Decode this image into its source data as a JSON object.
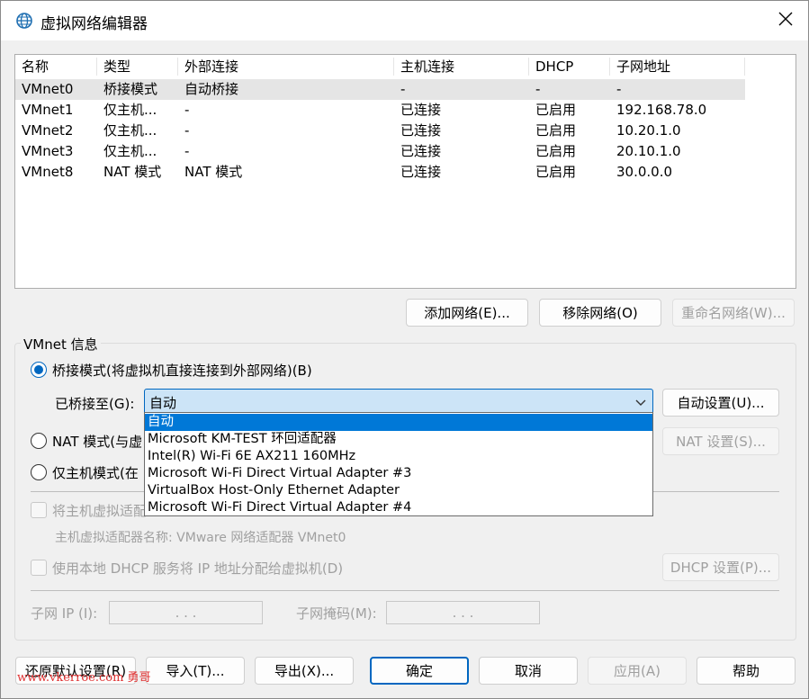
{
  "window": {
    "title": "虚拟网络编辑器"
  },
  "table": {
    "columns": [
      "名称",
      "类型",
      "外部连接",
      "主机连接",
      "DHCP",
      "子网地址"
    ],
    "rows": [
      [
        "VMnet0",
        "桥接模式",
        "自动桥接",
        "-",
        "-",
        "-"
      ],
      [
        "VMnet1",
        "仅主机...",
        "-",
        "已连接",
        "已启用",
        "192.168.78.0"
      ],
      [
        "VMnet2",
        "仅主机...",
        "-",
        "已连接",
        "已启用",
        "10.20.1.0"
      ],
      [
        "VMnet3",
        "仅主机...",
        "-",
        "已连接",
        "已启用",
        "20.10.1.0"
      ],
      [
        "VMnet8",
        "NAT 模式",
        "NAT 模式",
        "已连接",
        "已启用",
        "30.0.0.0"
      ]
    ],
    "selected_row": 0
  },
  "list_buttons": {
    "add": "添加网络(E)...",
    "remove": "移除网络(O)",
    "rename": "重命名网络(W)..."
  },
  "vmnet_info": {
    "title": "VMnet 信息",
    "bridge_label": "桥接模式(将虚拟机直接连接到外部网络)(B)",
    "bridged_to_label": "已桥接至(G):",
    "bridged_to_value": "自动",
    "auto_settings": "自动设置(U)...",
    "nat_label": "NAT 模式(与虚",
    "nat_settings": "NAT 设置(S)...",
    "hostonly_label": "仅主机模式(在",
    "connect_adapter_label": "将主机虚拟适配",
    "adapter_name_label": "主机虚拟适配器名称: VMware 网络适配器 VMnet0",
    "dhcp_label": "使用本地 DHCP 服务将 IP 地址分配给虚拟机(D)",
    "dhcp_settings": "DHCP 设置(P)...",
    "subnet_ip_label": "子网 IP (I):",
    "subnet_mask_label": "子网掩码(M):",
    "ip_dots": ". . ."
  },
  "dropdown": {
    "items": [
      "自动",
      "Microsoft KM-TEST 环回适配器",
      "Intel(R) Wi-Fi 6E AX211 160MHz",
      "Microsoft Wi-Fi Direct Virtual Adapter #3",
      "VirtualBox Host-Only Ethernet Adapter",
      "Microsoft Wi-Fi Direct Virtual Adapter #4"
    ],
    "selected_index": 0
  },
  "bottom_buttons": {
    "restore": "还原默认设置(R)",
    "import": "导入(T)...",
    "export": "导出(X)...",
    "ok": "确定",
    "cancel": "取消",
    "apply": "应用(A)",
    "help": "帮助"
  },
  "watermark": "www.vkerroe.com 勇哥",
  "colors": {
    "accent": "#0067c0",
    "selection": "#0078d7",
    "combo_bg": "#cce4f7"
  }
}
